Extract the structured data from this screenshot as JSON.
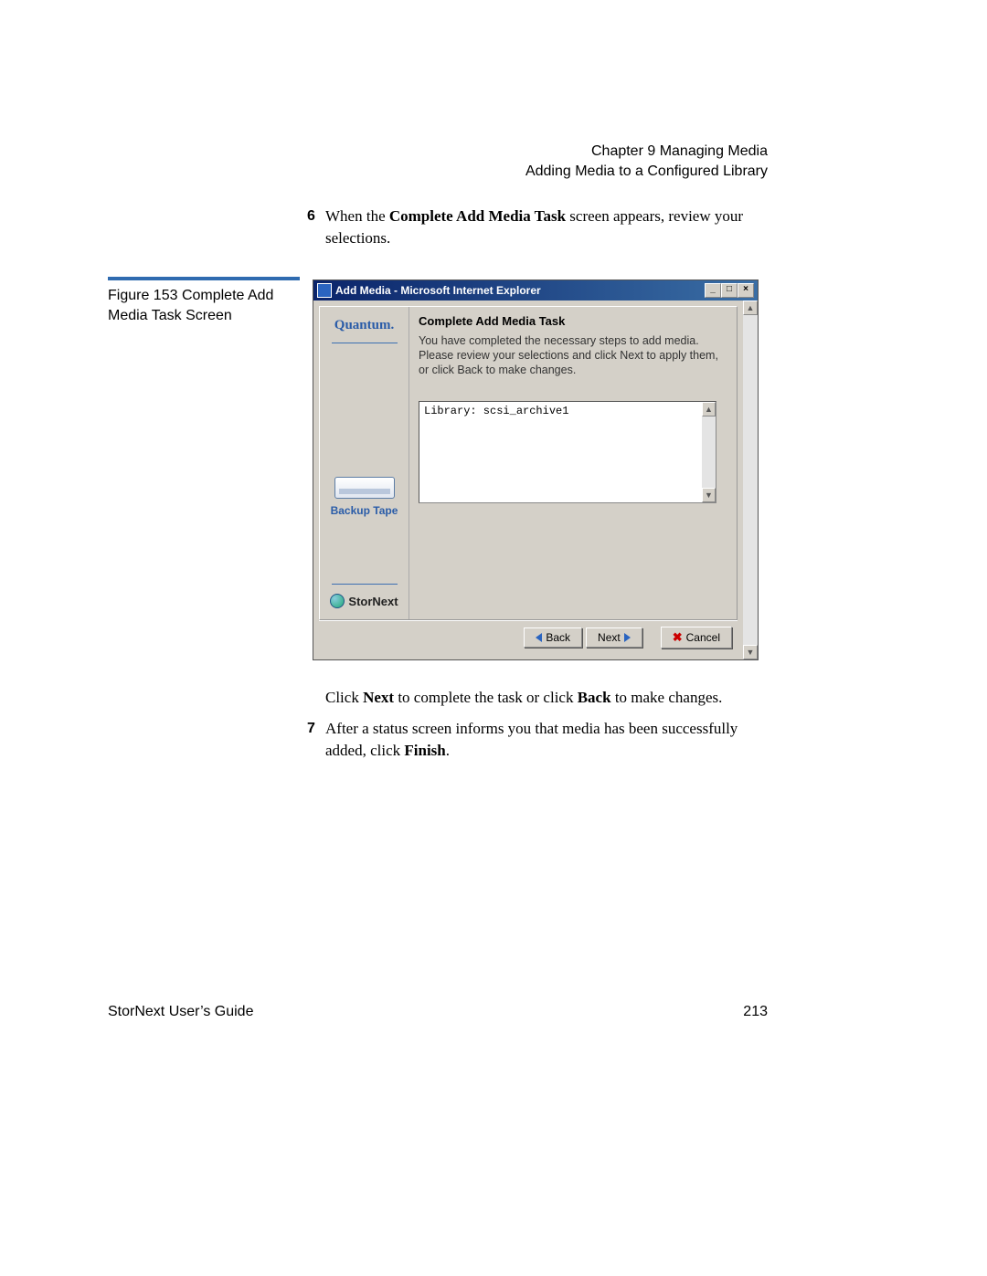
{
  "header": {
    "chapter": "Chapter 9  Managing Media",
    "section": "Adding Media to a Configured Library"
  },
  "steps": {
    "six": {
      "num": "6",
      "pre": "When the ",
      "bold": "Complete Add Media Task",
      "post": " screen appears, review your selections."
    },
    "after_text": {
      "pre": "Click ",
      "b1": "Next",
      "mid": " to complete the task or click ",
      "b2": "Back",
      "post": " to make changes."
    },
    "seven": {
      "num": "7",
      "pre": "After a status screen informs you that media has been successfully added, click ",
      "bold": "Finish",
      "post": "."
    }
  },
  "figure": {
    "caption": "Figure 153  Complete Add Media Task Screen"
  },
  "window": {
    "title": "Add Media - Microsoft Internet Explorer",
    "controls": {
      "min": "_",
      "max": "□",
      "close": "×"
    },
    "sidebar": {
      "brand": "Quantum.",
      "backup_label": "Backup Tape",
      "product": "StorNext"
    },
    "wizard": {
      "heading": "Complete Add Media Task",
      "body": "You have completed the necessary steps to add media. Please review your selections and click Next to apply them, or click Back to make changes.",
      "listbox_content": "Library: scsi_archive1",
      "scroll_up": "▲",
      "scroll_down": "▼"
    },
    "buttons": {
      "back": "Back",
      "next": "Next",
      "cancel": "Cancel"
    },
    "outer_scroll": {
      "up": "▲",
      "down": "▼"
    }
  },
  "footer": {
    "guide": "StorNext User’s Guide",
    "page": "213"
  }
}
